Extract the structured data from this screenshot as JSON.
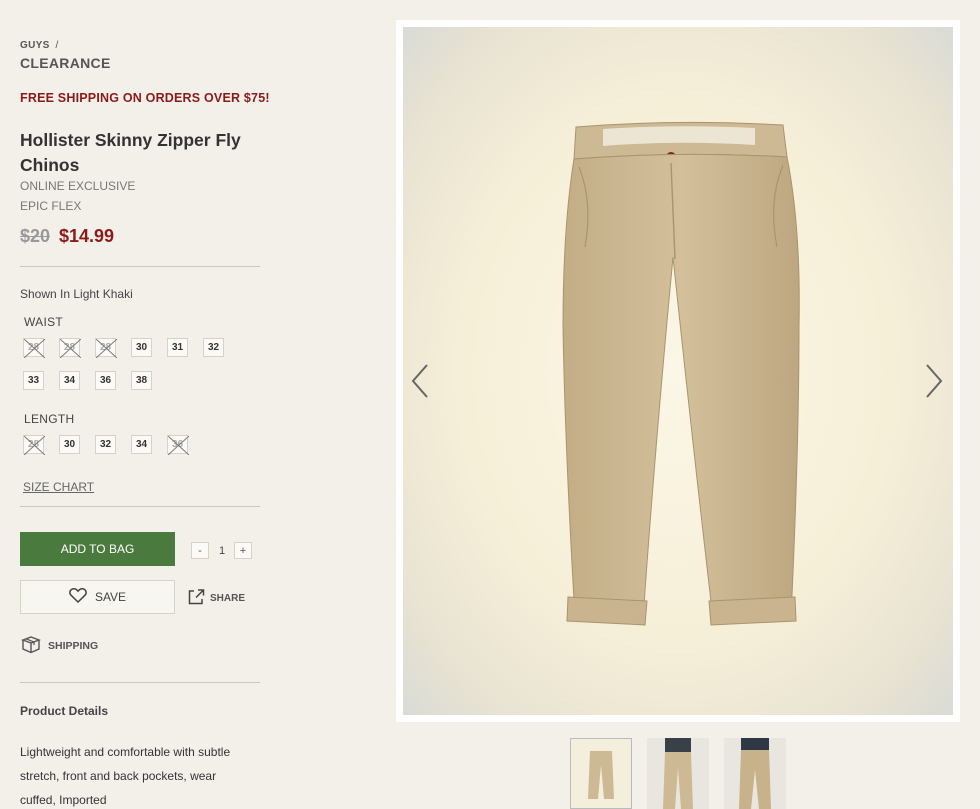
{
  "breadcrumb": {
    "parent": "GUYS",
    "separator": "/",
    "current": "CLEARANCE"
  },
  "promo": "FREE SHIPPING ON ORDERS OVER $75!",
  "product": {
    "title": "Hollister Skinny Zipper Fly Chinos",
    "tags": [
      "ONLINE EXCLUSIVE",
      "EPIC FLEX"
    ],
    "price_original": "$20",
    "price_sale": "$14.99",
    "shown_in": "Shown In Light Khaki"
  },
  "waist": {
    "label": "WAIST",
    "sizes": [
      {
        "v": "28",
        "available": false
      },
      {
        "v": "28",
        "available": false
      },
      {
        "v": "28",
        "available": false
      },
      {
        "v": "30",
        "available": true
      },
      {
        "v": "31",
        "available": true
      },
      {
        "v": "32",
        "available": true
      },
      {
        "v": "33",
        "available": true
      },
      {
        "v": "34",
        "available": true
      },
      {
        "v": "36",
        "available": true
      },
      {
        "v": "38",
        "available": true
      }
    ]
  },
  "length": {
    "label": "LENGTH",
    "sizes": [
      {
        "v": "28",
        "available": false
      },
      {
        "v": "30",
        "available": true
      },
      {
        "v": "32",
        "available": true
      },
      {
        "v": "34",
        "available": true
      },
      {
        "v": "36",
        "available": false
      }
    ]
  },
  "size_chart": "SIZE CHART",
  "actions": {
    "add_to_bag": "ADD TO BAG",
    "qty_minus": "-",
    "qty": "1",
    "qty_plus": "+",
    "save": "SAVE",
    "share": "SHARE",
    "shipping": "SHIPPING"
  },
  "details": {
    "heading": "Product Details",
    "text": "Lightweight and comfortable with subtle stretch, front and back pockets, wear cuffed, Imported"
  },
  "colors": {
    "sale_red": "#8b1a1a",
    "add_green": "#4a7a3e",
    "khaki": "#cdb892"
  }
}
